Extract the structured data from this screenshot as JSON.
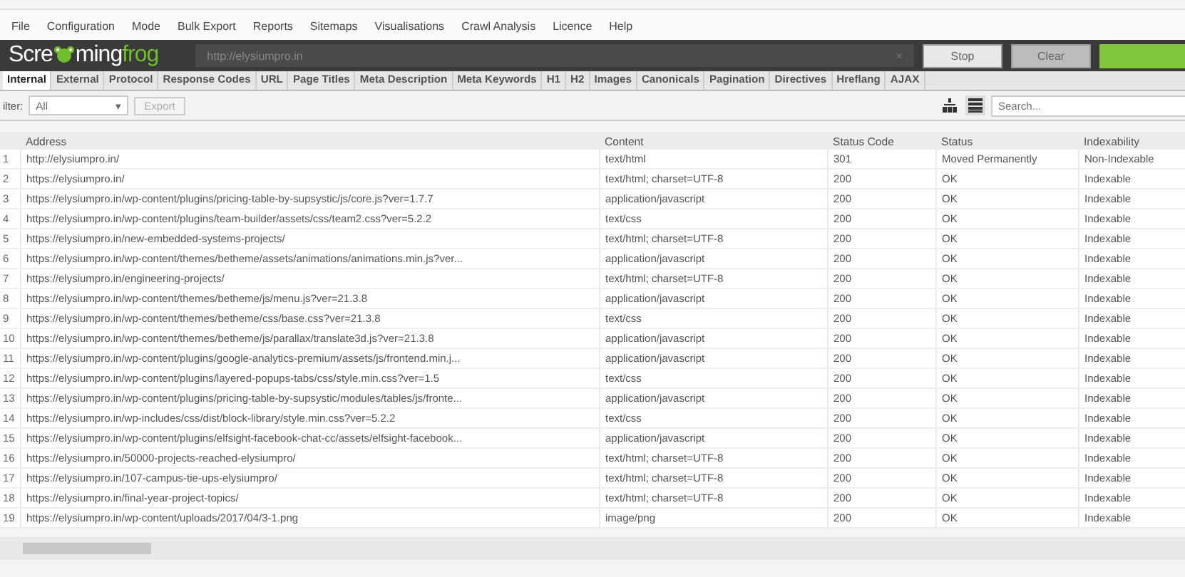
{
  "menu": [
    "File",
    "Configuration",
    "Mode",
    "Bulk Export",
    "Reports",
    "Sitemaps",
    "Visualisations",
    "Crawl Analysis",
    "Licence",
    "Help"
  ],
  "logo": {
    "part_1": "Scre",
    "part_2": "ming",
    "part_3": "frog"
  },
  "url_field": {
    "value": "http://elysiumpro.in",
    "clear": "×"
  },
  "buttons": [
    "Stop",
    "Clear"
  ],
  "progress": {
    "level": 1
  },
  "tabs": [
    {
      "label": "Internal",
      "selected": true
    },
    {
      "label": "External",
      "selected": false
    },
    {
      "label": "Protocol",
      "selected": false
    },
    {
      "label": "Response Codes",
      "selected": false
    },
    {
      "label": "URL",
      "selected": false
    },
    {
      "label": "Page Titles",
      "selected": false
    },
    {
      "label": "Meta Description",
      "selected": false
    },
    {
      "label": "Meta Keywords",
      "selected": false
    },
    {
      "label": "H1",
      "selected": false
    },
    {
      "label": "H2",
      "selected": false
    },
    {
      "label": "Images",
      "selected": false
    },
    {
      "label": "Canonicals",
      "selected": false
    },
    {
      "label": "Pagination",
      "selected": false
    },
    {
      "label": "Directives",
      "selected": false
    },
    {
      "label": "Hreflang",
      "selected": false
    },
    {
      "label": "AJAX",
      "selected": false
    }
  ],
  "filter": {
    "label": "ilter:",
    "value": "All",
    "arrow": "▾",
    "export": "Export",
    "export_disabled": true
  },
  "views": [
    {
      "kind": "tree",
      "selected": false
    },
    {
      "kind": "list",
      "selected": true
    }
  ],
  "search": {
    "placeholder": "Search..."
  },
  "table": {
    "columns": [
      "",
      "Address",
      "Content",
      "Status Code",
      "Status",
      "Indexability"
    ],
    "rows": [
      [
        "1",
        "http://elysiumpro.in/",
        "text/html",
        "301",
        "Moved Permanently",
        "Non-Indexable"
      ],
      [
        "2",
        "https://elysiumpro.in/",
        "text/html; charset=UTF-8",
        "200",
        "OK",
        "Indexable"
      ],
      [
        "3",
        "https://elysiumpro.in/wp-content/plugins/pricing-table-by-supsystic/js/core.js?ver=1.7.7",
        "application/javascript",
        "200",
        "OK",
        "Indexable"
      ],
      [
        "4",
        "https://elysiumpro.in/wp-content/plugins/team-builder/assets/css/team2.css?ver=5.2.2",
        "text/css",
        "200",
        "OK",
        "Indexable"
      ],
      [
        "5",
        "https://elysiumpro.in/new-embedded-systems-projects/",
        "text/html; charset=UTF-8",
        "200",
        "OK",
        "Indexable"
      ],
      [
        "6",
        "https://elysiumpro.in/wp-content/themes/betheme/assets/animations/animations.min.js?ver...",
        "application/javascript",
        "200",
        "OK",
        "Indexable"
      ],
      [
        "7",
        "https://elysiumpro.in/engineering-projects/",
        "text/html; charset=UTF-8",
        "200",
        "OK",
        "Indexable"
      ],
      [
        "8",
        "https://elysiumpro.in/wp-content/themes/betheme/js/menu.js?ver=21.3.8",
        "application/javascript",
        "200",
        "OK",
        "Indexable"
      ],
      [
        "9",
        "https://elysiumpro.in/wp-content/themes/betheme/css/base.css?ver=21.3.8",
        "text/css",
        "200",
        "OK",
        "Indexable"
      ],
      [
        "10",
        "https://elysiumpro.in/wp-content/themes/betheme/js/parallax/translate3d.js?ver=21.3.8",
        "application/javascript",
        "200",
        "OK",
        "Indexable"
      ],
      [
        "11",
        "https://elysiumpro.in/wp-content/plugins/google-analytics-premium/assets/js/frontend.min.j...",
        "application/javascript",
        "200",
        "OK",
        "Indexable"
      ],
      [
        "12",
        "https://elysiumpro.in/wp-content/plugins/layered-popups-tabs/css/style.min.css?ver=1.5",
        "text/css",
        "200",
        "OK",
        "Indexable"
      ],
      [
        "13",
        "https://elysiumpro.in/wp-content/plugins/pricing-table-by-supsystic/modules/tables/js/fronte...",
        "application/javascript",
        "200",
        "OK",
        "Indexable"
      ],
      [
        "14",
        "https://elysiumpro.in/wp-includes/css/dist/block-library/style.min.css?ver=5.2.2",
        "text/css",
        "200",
        "OK",
        "Indexable"
      ],
      [
        "15",
        "https://elysiumpro.in/wp-content/plugins/elfsight-facebook-chat-cc/assets/elfsight-facebook...",
        "application/javascript",
        "200",
        "OK",
        "Indexable"
      ],
      [
        "16",
        "https://elysiumpro.in/50000-projects-reached-elysiumpro/",
        "text/html; charset=UTF-8",
        "200",
        "OK",
        "Indexable"
      ],
      [
        "17",
        "https://elysiumpro.in/107-campus-tie-ups-elysiumpro/",
        "text/html; charset=UTF-8",
        "200",
        "OK",
        "Indexable"
      ],
      [
        "18",
        "https://elysiumpro.in/final-year-project-topics/",
        "text/html; charset=UTF-8",
        "200",
        "OK",
        "Indexable"
      ],
      [
        "19",
        "https://elysiumpro.in/wp-content/uploads/2017/04/3-1.png",
        "image/png",
        "200",
        "OK",
        "Indexable"
      ]
    ]
  }
}
